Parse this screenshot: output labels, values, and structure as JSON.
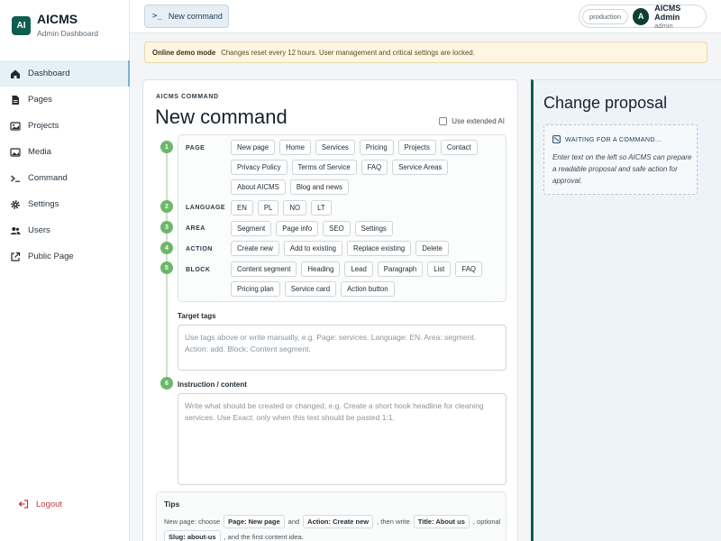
{
  "brand": {
    "logo": "AI",
    "name": "AICMS",
    "subtitle": "Admin Dashboard"
  },
  "sidebar": {
    "items": [
      {
        "label": "Dashboard",
        "icon": "home-icon",
        "active": true
      },
      {
        "label": "Pages",
        "icon": "file-icon",
        "active": false
      },
      {
        "label": "Projects",
        "icon": "image-icon",
        "active": false
      },
      {
        "label": "Media",
        "icon": "photo-icon",
        "active": false
      },
      {
        "label": "Command",
        "icon": "terminal-icon",
        "active": false
      },
      {
        "label": "Settings",
        "icon": "gear-icon",
        "active": false
      },
      {
        "label": "Users",
        "icon": "users-icon",
        "active": false
      },
      {
        "label": "Public Page",
        "icon": "external-link-icon",
        "active": false
      }
    ],
    "logout": "Logout"
  },
  "topbar": {
    "command_button": "New command",
    "env": "production",
    "avatar": "A",
    "user_name": "AICMS Admin",
    "user_role": "admin"
  },
  "banner": {
    "title": "Online demo mode",
    "text": "Changes reset every 12 hours. User management and critical settings are locked."
  },
  "command": {
    "kicker": "AICMS COMMAND",
    "title": "New command",
    "extended_ai": "Use extended AI",
    "steps": [
      "1",
      "2",
      "3",
      "4",
      "5",
      "6"
    ],
    "rows": {
      "page": {
        "label": "PAGE",
        "chips": [
          "New page",
          "Home",
          "Services",
          "Pricing",
          "Projects",
          "Contact",
          "Privacy Policy",
          "Terms of Service",
          "FAQ",
          "Service Areas",
          "About AICMS",
          "Blog and news"
        ]
      },
      "language": {
        "label": "LANGUAGE",
        "chips": [
          "EN",
          "PL",
          "NO",
          "LT"
        ]
      },
      "area": {
        "label": "AREA",
        "chips": [
          "Segment",
          "Page info",
          "SEO",
          "Settings"
        ]
      },
      "action": {
        "label": "ACTION",
        "chips": [
          "Create new",
          "Add to existing",
          "Replace existing",
          "Delete"
        ]
      },
      "block": {
        "label": "BLOCK",
        "chips": [
          "Content segment",
          "Heading",
          "Lead",
          "Paragraph",
          "List",
          "FAQ",
          "Pricing plan",
          "Service card",
          "Action button"
        ]
      }
    },
    "target_tags": {
      "label": "Target tags",
      "placeholder": "Use tags above or write manually, e.g. Page: services. Language: EN. Area: segment. Action: add. Block: Content segment."
    },
    "instruction": {
      "label": "Instruction / content",
      "placeholder": "Write what should be created or changed, e.g. Create a short hook headline for cleaning services. Use Exact: only when this text should be pasted 1:1."
    },
    "tips": {
      "title": "Tips",
      "line1_a": "New page: choose",
      "line1_k1": "Page: New page",
      "line1_b": "and",
      "line1_k2": "Action: Create new",
      "line1_c": ", then write",
      "line1_k3": "Title: About us",
      "line1_d": ", optional",
      "line2_k1": "Slug: about-us",
      "line2_a": ", and the first content idea."
    }
  },
  "proposal": {
    "title": "Change proposal",
    "status": "WAITING FOR A COMMAND...",
    "text": "Enter text on the left so AICMS can prepare a readable proposal and safe action for approval."
  },
  "colors": {
    "accent": "#0f5d4d",
    "step": "#6cb86a",
    "logout": "#c23b3b"
  }
}
